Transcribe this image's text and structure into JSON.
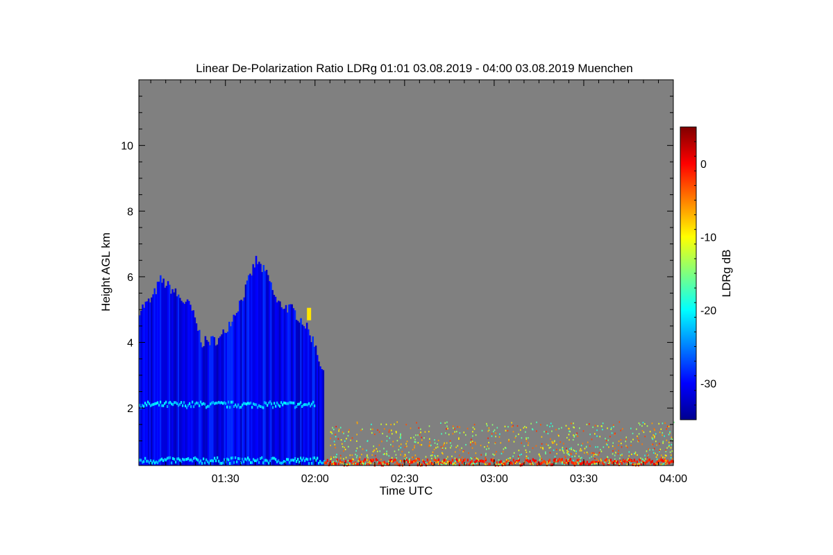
{
  "chart_data": {
    "type": "heatmap",
    "title": "Linear De-Polarization Ratio LDRg   01:01 03.08.2019 - 04:00 03.08.2019 Muenchen",
    "xlabel": "Time UTC",
    "ylabel": "Height AGL km",
    "x_unit": "time UTC (HH:MM)",
    "xlim": [
      "01:01",
      "04:00"
    ],
    "ylim": [
      0.25,
      12.0
    ],
    "x_ticks": [
      "01:30",
      "02:00",
      "02:30",
      "03:00",
      "03:30",
      "04:00"
    ],
    "y_ticks": [
      2,
      4,
      6,
      8,
      10
    ],
    "y_tick_labels": [
      "2",
      "4",
      "6",
      "8",
      "10"
    ],
    "background_color": "#808080",
    "colorbar": {
      "label": "LDRg dB",
      "range": [
        -35,
        5
      ],
      "ticks": [
        0,
        -10,
        -20,
        -30
      ],
      "tick_labels": [
        "0",
        "-10",
        "-20",
        "-30"
      ],
      "colormap": "jet"
    },
    "cloud_top_profile": [
      {
        "t": "01:01",
        "top_km": 5.0
      },
      {
        "t": "01:05",
        "top_km": 5.3
      },
      {
        "t": "01:08",
        "top_km": 5.9
      },
      {
        "t": "01:12",
        "top_km": 5.6
      },
      {
        "t": "01:15",
        "top_km": 5.3
      },
      {
        "t": "01:18",
        "top_km": 5.1
      },
      {
        "t": "01:22",
        "top_km": 4.0
      },
      {
        "t": "01:28",
        "top_km": 4.1
      },
      {
        "t": "01:33",
        "top_km": 4.9
      },
      {
        "t": "01:36",
        "top_km": 5.5
      },
      {
        "t": "01:40",
        "top_km": 6.5
      },
      {
        "t": "01:44",
        "top_km": 6.0
      },
      {
        "t": "01:47",
        "top_km": 5.2
      },
      {
        "t": "01:52",
        "top_km": 5.0
      },
      {
        "t": "01:56",
        "top_km": 4.6
      },
      {
        "t": "02:00",
        "top_km": 3.9
      },
      {
        "t": "02:03",
        "top_km": 2.8
      }
    ],
    "features": [
      {
        "name": "depolarization band",
        "t_start": "01:01",
        "t_end": "02:00",
        "height_km": 2.1,
        "ldr_db": -22
      },
      {
        "name": "cloud base signal",
        "t_start": "01:01",
        "t_end": "02:03",
        "height_km": 0.4,
        "ldr_db": -22
      },
      {
        "name": "near-ground layer",
        "t_start": "02:03",
        "t_end": "04:00",
        "height_km": 0.35,
        "ldr_db": -1
      },
      {
        "name": "scattered returns",
        "t_start": "02:05",
        "t_end": "04:00",
        "height_km": 1.0,
        "ldr_db": -10
      },
      {
        "name": "ice spot",
        "t": "01:58",
        "height_km": 4.8,
        "ldr_db": -9
      }
    ]
  }
}
